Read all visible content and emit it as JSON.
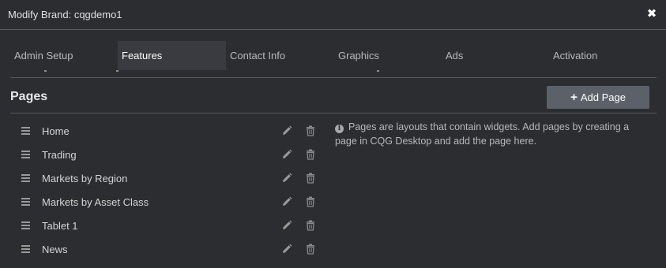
{
  "dialog": {
    "title": "Modify Brand: cqgdemo1"
  },
  "tabs": [
    {
      "label": "Admin Setup",
      "active": false
    },
    {
      "label": "Features",
      "active": true
    },
    {
      "label": "Contact Info",
      "active": false
    },
    {
      "label": "Graphics",
      "active": false
    },
    {
      "label": "Ads",
      "active": false
    },
    {
      "label": "Activation",
      "active": false
    }
  ],
  "pages_section": {
    "title": "Pages",
    "add_button_label": "Add Page",
    "items": [
      {
        "label": "Home"
      },
      {
        "label": "Trading"
      },
      {
        "label": "Markets by Region"
      },
      {
        "label": "Markets by Asset Class"
      },
      {
        "label": "Tablet 1"
      },
      {
        "label": "News"
      }
    ],
    "info_text": "Pages are layouts that contain widgets. Add pages by creating a page in CQG Desktop and add the page here."
  },
  "icons": {
    "close": "close-icon",
    "drag": "drag-handle-icon",
    "edit": "pencil-icon",
    "delete": "trash-icon",
    "info": "info-icon",
    "add": "plus-icon"
  },
  "colors": {
    "background": "#2c2d31",
    "active_tab": "#3a3b40",
    "button": "#5c6068"
  }
}
